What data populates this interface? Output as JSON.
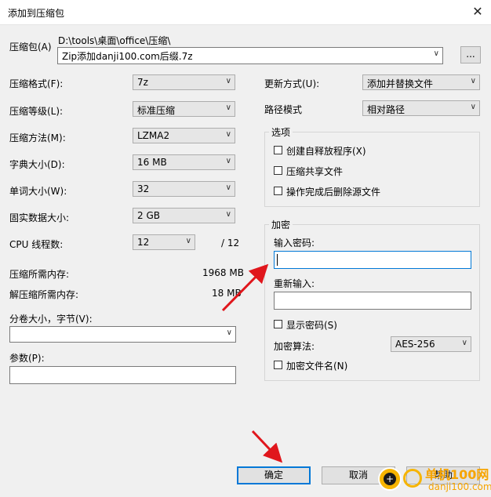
{
  "window": {
    "title": "添加到压缩包",
    "close_glyph": "✕"
  },
  "archive": {
    "label": "压缩包(A)",
    "path": "D:\\tools\\桌面\\office\\压缩\\",
    "name": "Zip添加danji100.com后缀.7z",
    "browse_label": "..."
  },
  "left": {
    "format": {
      "label": "压缩格式(F):",
      "value": "7z"
    },
    "level": {
      "label": "压缩等级(L):",
      "value": "标准压缩"
    },
    "method": {
      "label": "压缩方法(M):",
      "value": "LZMA2"
    },
    "dict": {
      "label": "字典大小(D):",
      "value": "16 MB"
    },
    "word": {
      "label": "单词大小(W):",
      "value": "32"
    },
    "solid": {
      "label": "固实数据大小:",
      "value": "2 GB"
    },
    "cpu": {
      "label": "CPU 线程数:",
      "value": "12",
      "max": "/ 12"
    },
    "mem_compress": {
      "label": "压缩所需内存:",
      "value": "1968 MB"
    },
    "mem_decompress": {
      "label": "解压缩所需内存:",
      "value": "18 MB"
    },
    "split": {
      "label": "分卷大小，字节(V):",
      "value": ""
    },
    "params": {
      "label": "参数(P):",
      "value": ""
    }
  },
  "right": {
    "update": {
      "label": "更新方式(U):",
      "value": "添加并替换文件"
    },
    "pathmode": {
      "label": "路径模式",
      "value": "相对路径"
    },
    "options": {
      "title": "选项",
      "items": [
        {
          "label": "创建自释放程序(X)",
          "checked": false
        },
        {
          "label": "压缩共享文件",
          "checked": false
        },
        {
          "label": "操作完成后删除源文件",
          "checked": false
        }
      ]
    },
    "encryption": {
      "title": "加密",
      "password_label": "输入密码:",
      "password_value": "",
      "reenter_label": "重新输入:",
      "reenter_value": "",
      "show_password_label": "显示密码(S)",
      "method_label": "加密算法:",
      "method_value": "AES-256",
      "encrypt_names_label": "加密文件名(N)"
    }
  },
  "buttons": {
    "ok": "确定",
    "cancel": "取消",
    "help": "帮助"
  },
  "watermark": {
    "cn": "单机100网",
    "url": "danji100.com"
  },
  "accent": {
    "arrow": "#e0161c",
    "focus": "#0078d7"
  }
}
